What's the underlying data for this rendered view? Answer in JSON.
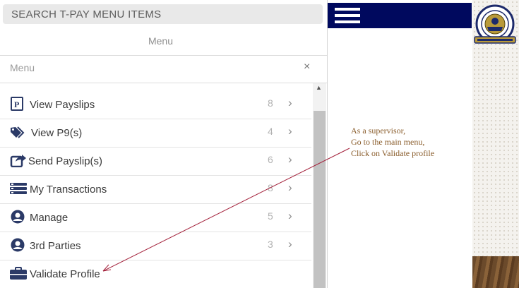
{
  "search": {
    "placeholder": "SEARCH T-PAY MENU ITEMS"
  },
  "menu": {
    "title": "Menu",
    "header_label": "Menu",
    "close_symbol": "×",
    "items": [
      {
        "label": "View Payslips",
        "count": "8",
        "icon": "payslip-icon"
      },
      {
        "label": "View P9(s)",
        "count": "4",
        "icon": "tags-icon"
      },
      {
        "label": "Send Payslip(s)",
        "count": "6",
        "icon": "share-icon"
      },
      {
        "label": "My Transactions",
        "count": "8",
        "icon": "list-icon"
      },
      {
        "label": "Manage",
        "count": "5",
        "icon": "user-circle-icon"
      },
      {
        "label": "3rd Parties",
        "count": "3",
        "icon": "user-circle-icon"
      },
      {
        "label": "Validate Profile",
        "count": "",
        "icon": "briefcase-icon"
      }
    ]
  },
  "annotation": {
    "lines": [
      "As a supervisor,",
      "Go to the main menu,",
      "Click on Validate profile"
    ]
  },
  "colors": {
    "topbar": "#00095e",
    "annotation": "#8a5d2c",
    "arrow": "#a3203a"
  }
}
